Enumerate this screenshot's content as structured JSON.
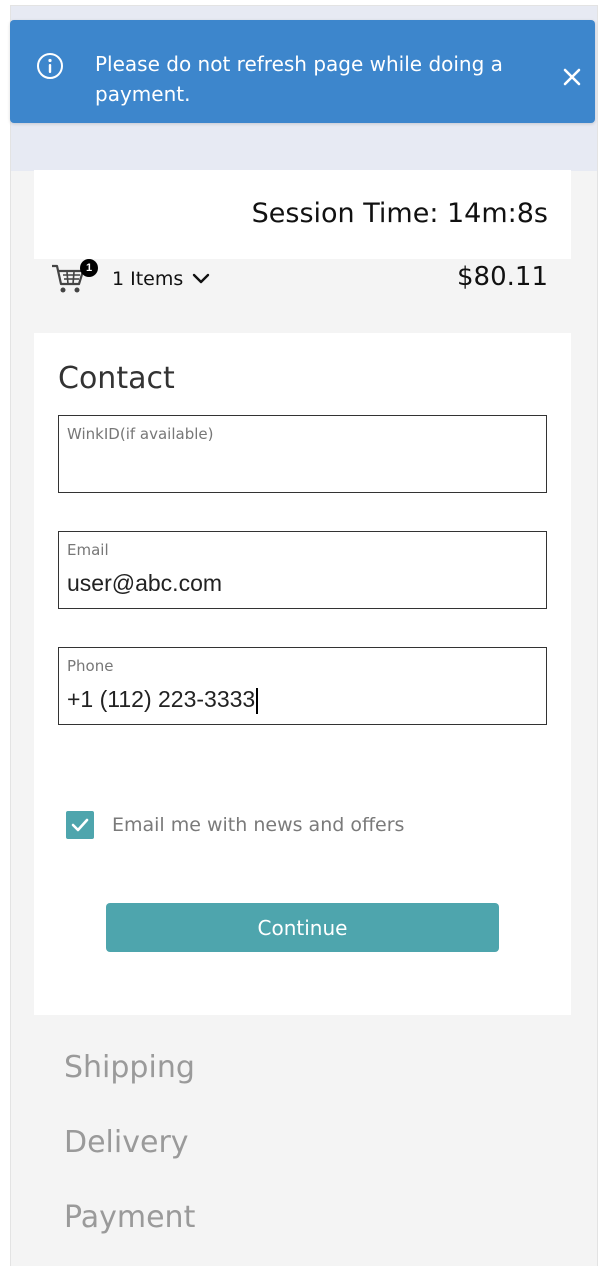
{
  "alert": {
    "message": "Please do not refresh page while doing a payment.",
    "icon": "info-icon",
    "close_icon": "close-icon",
    "background_color": "#3d86cc"
  },
  "session": {
    "text": "Session Time: 14m:8s"
  },
  "cart": {
    "badge_count": "1",
    "items_label": "1 Items",
    "total": "$80.11"
  },
  "contact": {
    "title": "Contact",
    "fields": [
      {
        "label": "WinkID(if available)",
        "value": ""
      },
      {
        "label": "Email",
        "value": "user@abc.com"
      },
      {
        "label": "Phone",
        "value": "+1 (112) 223-3333"
      }
    ],
    "newsletter": {
      "label": "Email me with news and offers",
      "checked": true
    },
    "continue_label": "Continue",
    "accent_color": "#4ea5ad"
  },
  "steps": [
    {
      "label": "Shipping"
    },
    {
      "label": "Delivery"
    },
    {
      "label": "Payment"
    }
  ]
}
